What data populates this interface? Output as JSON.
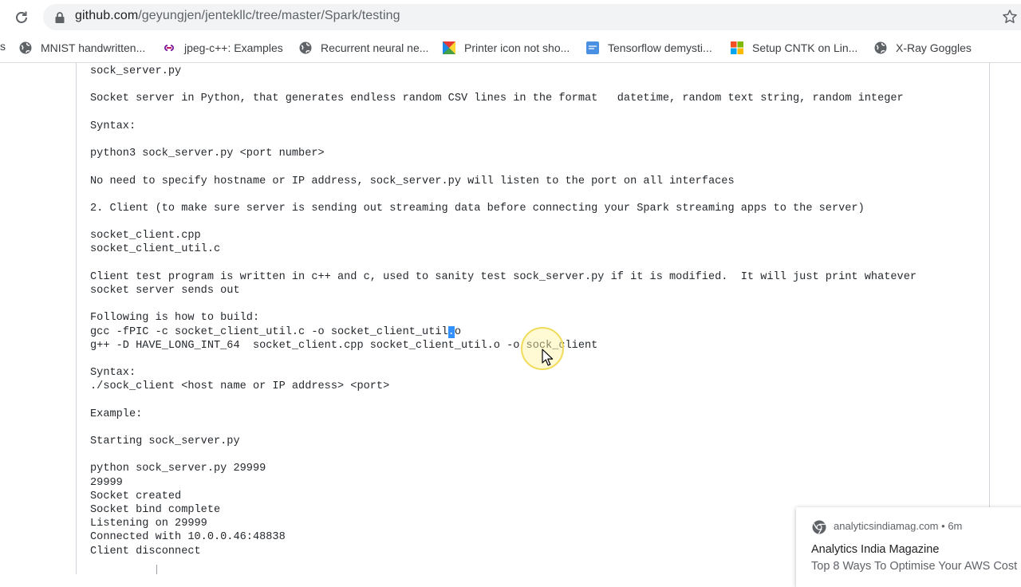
{
  "browser": {
    "url_host": "github.com",
    "url_path": "/geyungjen/jentekllc/tree/master/Spark/testing",
    "bookmarks": [
      {
        "label": "MNIST handwritten...",
        "icon": "globe-icon"
      },
      {
        "label": "jpeg-c++: Examples",
        "icon": "link-icon"
      },
      {
        "label": "Recurrent neural ne...",
        "icon": "globe-icon"
      },
      {
        "label": "Printer icon not sho...",
        "icon": "colorful-square-icon"
      },
      {
        "label": "Tensorflow demysti...",
        "icon": "blue-doc-icon"
      },
      {
        "label": "Setup CNTK on Lin...",
        "icon": "windows-logo-icon"
      },
      {
        "label": "X-Ray Goggles",
        "icon": "globe-icon"
      }
    ],
    "bookmark_edge": "s"
  },
  "readme": {
    "lines": [
      "sock_server.py",
      "",
      "Socket server in Python, that generates endless random CSV lines in the format   datetime, random text string, random integer",
      "",
      "Syntax:",
      "",
      "python3 sock_server.py <port number>",
      "",
      "No need to specify hostname or IP address, sock_server.py will listen to the port on all interfaces",
      "",
      "2. Client (to make sure server is sending out streaming data before connecting your Spark streaming apps to the server)",
      "",
      "socket_client.cpp",
      "socket_client_util.c",
      "",
      "Client test program is written in c++ and c, used to sanity test sock_server.py if it is modified.  It will just print whatever",
      "socket server sends out",
      "",
      "Following is how to build:",
      "gcc -fPIC -c socket_client_util.c -o socket_client_util",
      "g++ -D HAVE_LONG_INT_64  socket_client.cpp socket_client_util.o -o sock_client",
      "",
      "Syntax:",
      "./sock_client <host name or IP address> <port>",
      "",
      "Example:",
      "",
      "Starting sock_server.py",
      "",
      "python sock_server.py 29999",
      "29999",
      "Socket created",
      "Socket bind complete",
      "Listening on 29999",
      "Connected with 10.0.0.46:48838",
      "Client disconnect"
    ],
    "selected_fragment": ".",
    "after_selection": "o"
  },
  "notification": {
    "source": "analyticsindiamag.com",
    "age": "6m",
    "separator": "•",
    "title": "Analytics India Magazine",
    "body": "Top 8 Ways To Optimise Your AWS Cost"
  }
}
